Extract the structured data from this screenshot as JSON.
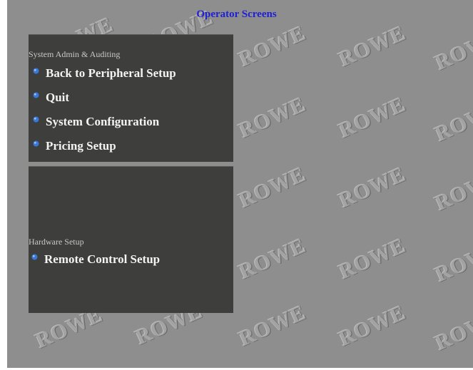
{
  "page": {
    "title": "Operator Screens",
    "watermark_text": "ROWE"
  },
  "sections": [
    {
      "header": "System Admin & Auditing",
      "items": [
        {
          "label": "Back to Peripheral Setup",
          "icon": "bullet-icon"
        },
        {
          "label": "Quit",
          "icon": "bullet-icon"
        },
        {
          "label": "System Configuration",
          "icon": "bullet-icon"
        },
        {
          "label": "Pricing Setup",
          "icon": "bullet-icon"
        }
      ]
    },
    {
      "header": "Hardware Setup",
      "items": [
        {
          "label": "Remote Control Setup",
          "icon": "bullet-icon"
        }
      ]
    }
  ],
  "colors": {
    "background": "#8e8e8e",
    "panel": "#3e3e3c",
    "title": "#1f1fd6",
    "item_text": "#f4f4f4",
    "header_text": "#c9c9c9",
    "bullet": "#3a78d8"
  }
}
